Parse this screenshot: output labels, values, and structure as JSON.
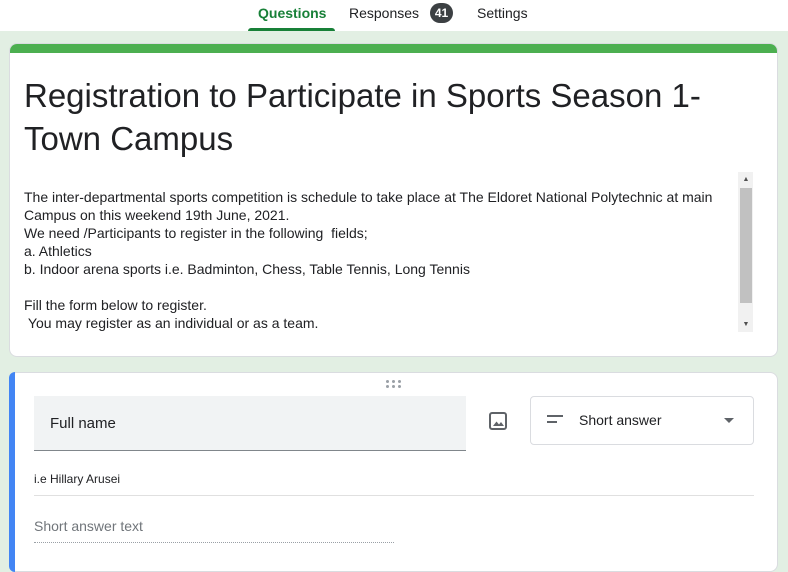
{
  "tabs": {
    "questions": "Questions",
    "responses": "Responses",
    "responses_count": "41",
    "settings": "Settings"
  },
  "form": {
    "title": "Registration to Participate in Sports Season 1- Town Campus",
    "description": "The inter-departmental sports competition is schedule to take place at The Eldoret National Polytechnic at main Campus on this weekend 19th June, 2021.\nWe need /Participants to register in the following  fields;\na. Athletics\nb. Indoor arena sports i.e. Badminton, Chess, Table Tennis, Long Tennis\n\nFill the form below to register.\n You may register as an individual or as a team."
  },
  "question": {
    "title": "Full name",
    "type": "Short answer",
    "description": "i.e Hillary Arusei",
    "answer_placeholder": "Short answer text"
  },
  "colors": {
    "accent": "#188038",
    "header_strip": "#4caf50",
    "question_accent": "#4285f4",
    "background": "#e2efe3"
  },
  "icons": {
    "image": "image-icon",
    "short_answer": "short-text-icon",
    "dropdown": "chevron-down-icon",
    "drag": "drag-handle-icon"
  }
}
